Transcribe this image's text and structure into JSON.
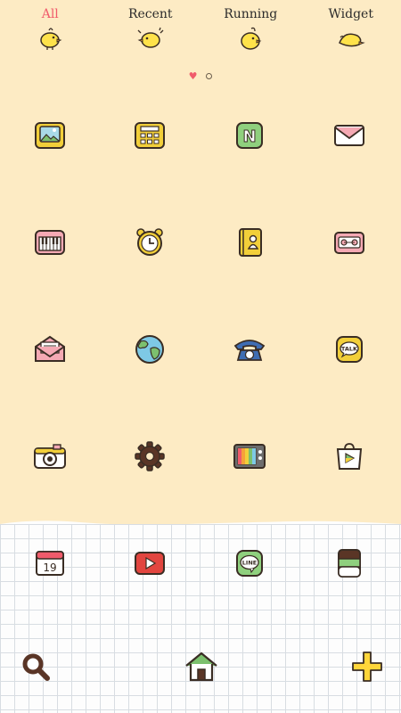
{
  "tabs": [
    {
      "label": "All",
      "active": true
    },
    {
      "label": "Recent",
      "active": false
    },
    {
      "label": "Running",
      "active": false
    },
    {
      "label": "Widget",
      "active": false
    }
  ],
  "colors": {
    "background": "#fdebc4",
    "active_tab": "#f05b6b",
    "outline": "#3a2d24"
  },
  "pager": {
    "pages": 2,
    "current": 1
  },
  "apps": [
    {
      "icon": "gallery-icon"
    },
    {
      "icon": "calculator-icon"
    },
    {
      "icon": "naver-icon",
      "label": "N"
    },
    {
      "icon": "mail-icon"
    },
    {
      "icon": "piano-icon"
    },
    {
      "icon": "alarm-clock-icon"
    },
    {
      "icon": "contacts-icon"
    },
    {
      "icon": "radio-cassette-icon"
    },
    {
      "icon": "message-envelope-icon"
    },
    {
      "icon": "globe-icon"
    },
    {
      "icon": "telephone-icon"
    },
    {
      "icon": "kakaotalk-icon",
      "label": "TALK"
    },
    {
      "icon": "camera-icon"
    },
    {
      "icon": "settings-gear-icon"
    },
    {
      "icon": "tv-icon"
    },
    {
      "icon": "play-store-icon"
    }
  ],
  "dock_apps": [
    {
      "icon": "calendar-icon",
      "label": "19"
    },
    {
      "icon": "youtube-icon"
    },
    {
      "icon": "line-icon",
      "label": "LINE"
    },
    {
      "icon": "wallet-icon"
    }
  ],
  "bottom": {
    "search": "search-icon",
    "home": "home-icon",
    "add": "plus-icon"
  }
}
